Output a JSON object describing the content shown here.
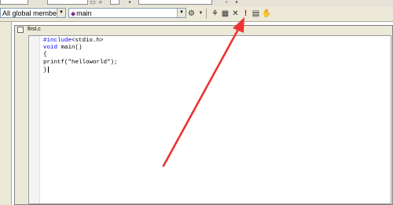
{
  "toolbar": {
    "class_combo": "All global members",
    "member_combo": "main",
    "compile_icon": "compile-icon",
    "build_icon": "build-icon",
    "stop_icon": "stop-build-icon",
    "execute_icon": "execute-icon",
    "breakpoint_icon": "breakpoint-icon",
    "go_icon": "go-icon",
    "execute_color": "#dd0000"
  },
  "document": {
    "title": "first.c"
  },
  "editor": {
    "lines": [
      {
        "pre": "",
        "kw": "#include",
        "rest": "<stdio.h>"
      },
      {
        "pre": "",
        "kw": "void",
        "rest": " main()"
      },
      {
        "pre": "",
        "kw": "",
        "rest": "{"
      },
      {
        "pre": "",
        "kw": "",
        "rest": "printf(\"helloworld\");"
      },
      {
        "pre": "",
        "kw": "",
        "rest": "}"
      }
    ]
  },
  "annotation": {
    "arrow_color": "#ee3333"
  }
}
